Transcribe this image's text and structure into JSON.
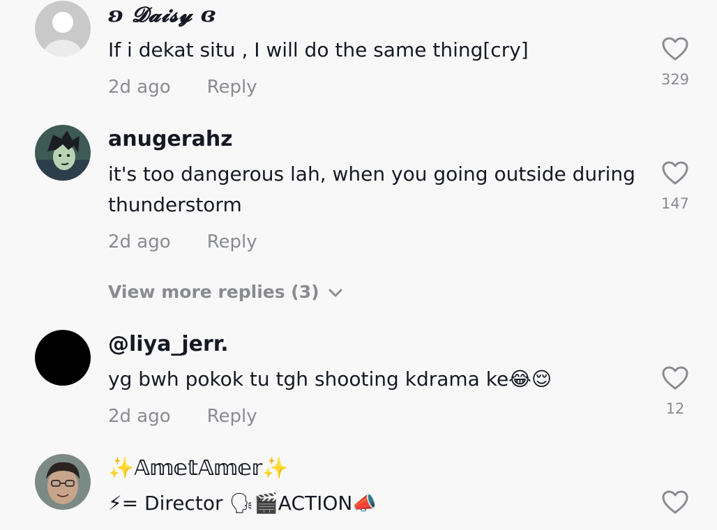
{
  "comments": [
    {
      "username": "ʚ 𝓓𝓪𝓲𝓼𝔂 ɞ",
      "text": "If i dekat situ , I will do the same thing[cry]",
      "time": "2d ago",
      "reply_label": "Reply",
      "likes": "329"
    },
    {
      "username": "anugerahz",
      "text": "it's too dangerous lah, when you going outside during thunderstorm",
      "time": "2d ago",
      "reply_label": "Reply",
      "likes": "147",
      "view_more": "View more replies (3)"
    },
    {
      "username": "@liya_jerr.",
      "text": "yg bwh pokok tu tgh shooting kdrama ke😂😌",
      "time": "2d ago",
      "reply_label": "Reply",
      "likes": "12"
    },
    {
      "username": "✨𝔸𝕞𝕖𝕥𝔸𝕞𝕖𝕣✨",
      "text": "⚡= Director 🗣🎬ACTION📣"
    }
  ],
  "icons": {
    "like": "heart-outline-icon",
    "expand": "chevron-down-icon"
  },
  "colors": {
    "background": "#f8f8f8",
    "primary_text": "#161823",
    "secondary_text": "#8a8b91"
  }
}
